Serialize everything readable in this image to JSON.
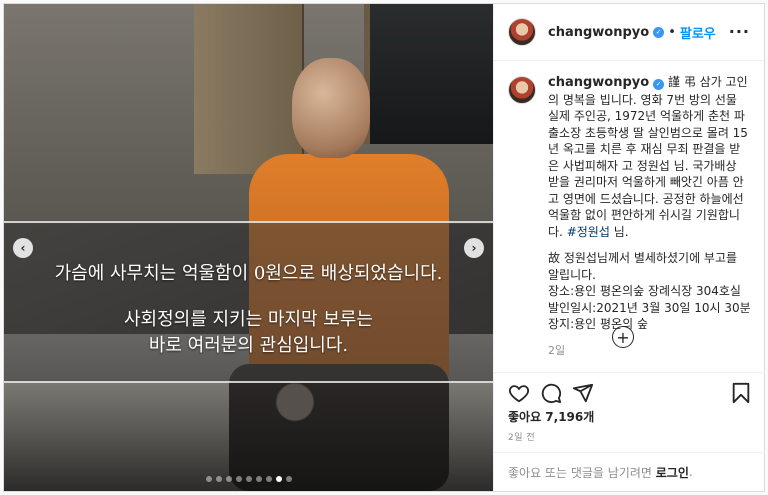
{
  "post": {
    "username": "changwonpyo",
    "follow_label": "팔로우",
    "separator": "•",
    "more_icon": "more-horizontal-icon"
  },
  "media": {
    "caption_line1": "가슴에 사무치는 억울함이 0원으로 배상되었습니다.",
    "caption_line2": "사회정의를 지키는 마지막 보루는",
    "caption_line3": "바로 여러분의 관심입니다.",
    "prev_icon": "chevron-left-icon",
    "next_icon": "chevron-right-icon",
    "slide_count": 9,
    "active_slide_index": 7
  },
  "caption": {
    "username": "changwonpyo",
    "text_part1": "謹 弔 삼가 고인의 명복을 빕니다. 영화 7번 방의 선물 실제 주인공, 1972년 억울하게 춘천 파출소장 초등학생 딸 살인범으로 몰려 15년 옥고를 치른 후 재심 무죄 판결을 받은 사법피해자 고 정원섭 님. 국가배상 받을 권리마저 억울하게 빼앗긴 아픔 안고 영면에 드셨습니다. 공정한 하늘에선 억울함 없이 편안하게 쉬시길 기원합니다.",
    "hashtag": "#정원섭",
    "text_part2": " 님.",
    "para2_line1": "故 정원섭님께서 별세하셨기에 부고를 알립니다.",
    "para2_line2": "장소:용인 평온의숲 장례식장 304호실",
    "para2_line3": "발인일시:2021년 3월 30일 10시 30분",
    "para2_line4": "장지:용인 평온의 숲",
    "time_ago": "2일"
  },
  "actions": {
    "like_icon": "heart-icon",
    "comment_icon": "comment-icon",
    "share_icon": "share-icon",
    "save_icon": "bookmark-icon",
    "load_more_icon": "plus-circle-icon",
    "likes_text": "좋아요 7,196개",
    "date_text": "2일 전"
  },
  "comment_box": {
    "prompt_text": "좋아요 또는 댓글을 남기려면 ",
    "login_label": "로그인",
    "suffix": "."
  },
  "colors": {
    "accent": "#0095f6",
    "verified": "#3897f0",
    "hashtag": "#00376b",
    "muted": "#8e8e8e"
  }
}
